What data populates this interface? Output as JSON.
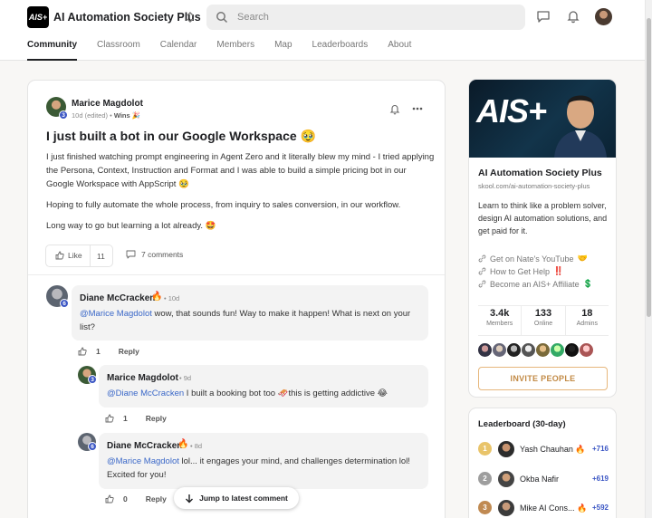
{
  "header": {
    "logo_text": "AIS+",
    "group_name": "AI Automation Society Plus",
    "search_placeholder": "Search"
  },
  "tabs": [
    "Community",
    "Classroom",
    "Calendar",
    "Members",
    "Map",
    "Leaderboards",
    "About"
  ],
  "post": {
    "author": "Marice Magdolot",
    "author_level": "3",
    "meta_time": "10d (edited) • ",
    "meta_category": "Wins",
    "meta_emoji": "🎉",
    "title": "I just built a bot in our Google Workspace 🥹",
    "paragraphs": [
      "I just finished watching prompt engineering in Agent Zero and it literally blew my mind - I tried applying the Persona, Context, Instruction and Format and I was able to build a simple pricing bot in our Google Workspace with AppScript 🥹",
      "Hoping to fully automate the whole process, from inquiry to sales conversion, in our workflow.",
      "Long way to go but learning a lot already. 🤩"
    ],
    "like_label": "Like",
    "like_count": "11",
    "comments_label": "7 comments"
  },
  "comments": [
    {
      "author": "Diane McCracken",
      "level": "6",
      "badge": "🔥",
      "time": "• 10d",
      "mention": "@Marice Magdolot",
      "text": " wow, that sounds fun! Way to make it happen! What is next on your list?",
      "likes": "1",
      "reply": "Reply"
    },
    {
      "author": "Marice Magdolot",
      "level": "3",
      "badge": "",
      "time": "• 9d",
      "mention": "@Diane McCracken",
      "text": " I built a booking bot too 🛷this is getting addictive 😂",
      "likes": "1",
      "reply": "Reply"
    },
    {
      "author": "Diane McCracken",
      "level": "6",
      "badge": "🔥",
      "time": "• 8d",
      "mention": "@Marice Magdolot",
      "text": " lol... it engages your mind, and challenges determination lol! Excited for you!",
      "likes": "0",
      "reply": "Reply"
    }
  ],
  "jump_button": "Jump to latest comment",
  "about": {
    "banner_text": "AIS+",
    "name": "AI Automation Society Plus",
    "url": "skool.com/ai-automation-society-plus",
    "description": "Learn to think like a problem solver, design AI automation solutions, and get paid for it.",
    "links": [
      {
        "label": "Get on Nate's YouTube",
        "emoji": "🤝"
      },
      {
        "label": "How to Get Help",
        "emoji": "‼️"
      },
      {
        "label": "Become an AIS+ Affiliate",
        "emoji": "💲"
      }
    ],
    "stats": [
      {
        "value": "3.4k",
        "label": "Members"
      },
      {
        "value": "133",
        "label": "Online"
      },
      {
        "value": "18",
        "label": "Admins"
      }
    ],
    "invite_label": "INVITE PEOPLE"
  },
  "leaderboard": {
    "title": "Leaderboard (30-day)",
    "rows": [
      {
        "rank": "1",
        "name": "Yash Chauhan",
        "badge": "🔥",
        "points": "+716",
        "medal_color": "#e9c46a"
      },
      {
        "rank": "2",
        "name": "Okba Nafir",
        "badge": "",
        "points": "+619",
        "medal_color": "#9e9e9e"
      },
      {
        "rank": "3",
        "name": "Mike AI Cons...",
        "badge": "🔥",
        "points": "+592",
        "medal_color": "#c08a52"
      }
    ]
  },
  "colors": {
    "accent_blue": "#3b56c4",
    "mention_blue": "#3b68c8",
    "invite_gold": "#c28a45"
  }
}
